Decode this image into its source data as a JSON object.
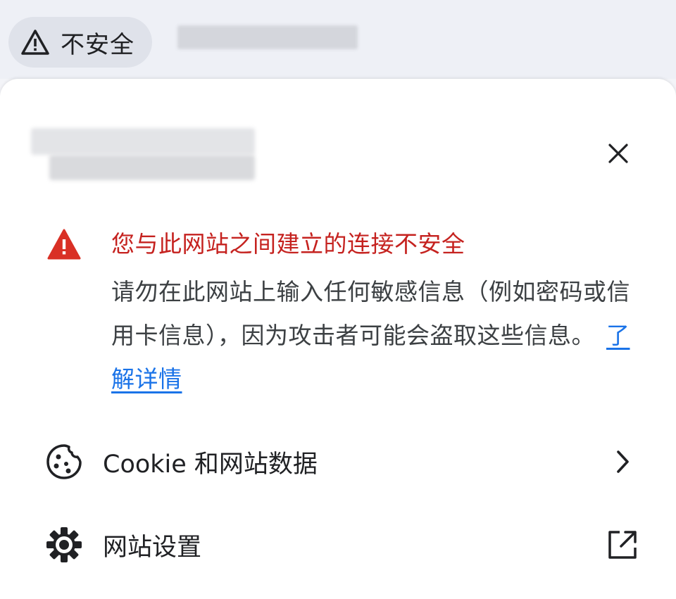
{
  "omnibar": {
    "security_chip_label": "不安全",
    "security_chip_icon": "warning-triangle-icon"
  },
  "panel": {
    "close_icon": "close-icon",
    "warning": {
      "icon": "warning-triangle-filled-icon",
      "icon_color": "#d93025",
      "title": "您与此网站之间建立的连接不安全",
      "body": "请勿在此网站上输入任何敏感信息（例如密码或信用卡信息），因为攻击者可能会盗取这些信息。",
      "learn_more": "了解详情"
    },
    "rows": [
      {
        "label": "Cookie 和网站数据",
        "icon": "cookie-icon",
        "trailing_icon": "chevron-right-icon"
      },
      {
        "label": "网站设置",
        "icon": "gear-icon",
        "trailing_icon": "open-in-new-icon"
      }
    ]
  },
  "colors": {
    "warning_red": "#c5221f",
    "link_blue": "#1a73e8",
    "text": "#202124"
  }
}
